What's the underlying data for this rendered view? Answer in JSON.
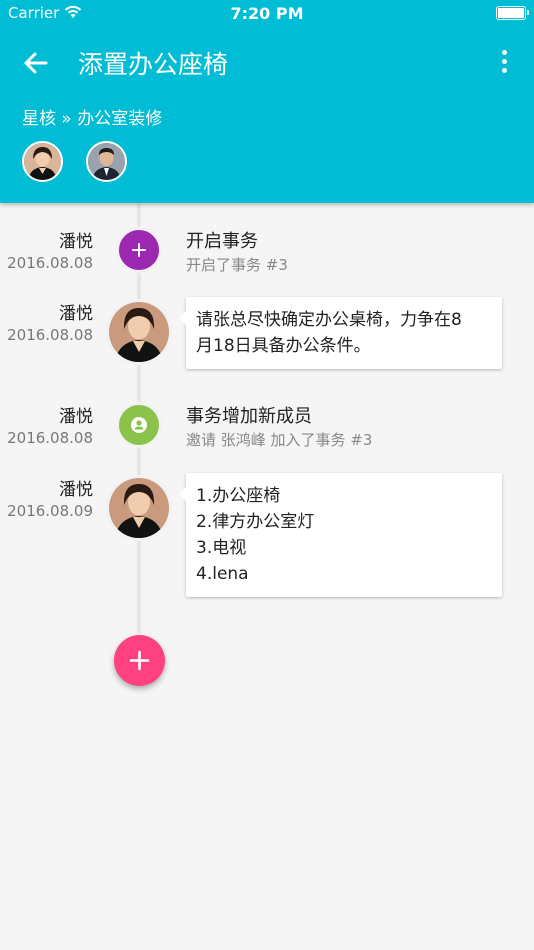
{
  "status_bar": {
    "carrier": "Carrier",
    "time": "7:20 PM"
  },
  "toolbar": {
    "title": "添置办公座椅"
  },
  "breadcrumb": {
    "text": "星核 » 办公室装修"
  },
  "colors": {
    "header": "#00bcd4",
    "fab": "#ff4081",
    "event_create": "#9c27b0",
    "event_member": "#8bc34a"
  },
  "timeline": [
    {
      "name": "潘悦",
      "date": "2016.08.08",
      "title": "开启事务",
      "subtitle": "开启了事务 #3",
      "icon": "plus-icon"
    },
    {
      "name": "潘悦",
      "date": "2016.08.08",
      "lines": [
        "请张总尽快确定办公桌椅，力争在8",
        "月18日具备办公条件。"
      ]
    },
    {
      "name": "潘悦",
      "date": "2016.08.08",
      "title": "事务增加新成员",
      "subtitle": "邀请 张鸿峰 加入了事务 #3",
      "icon": "person-icon"
    },
    {
      "name": "潘悦",
      "date": "2016.08.09",
      "lines": [
        "1.办公座椅",
        "2.律方办公室灯",
        "3.电视",
        "4.lena"
      ]
    }
  ]
}
